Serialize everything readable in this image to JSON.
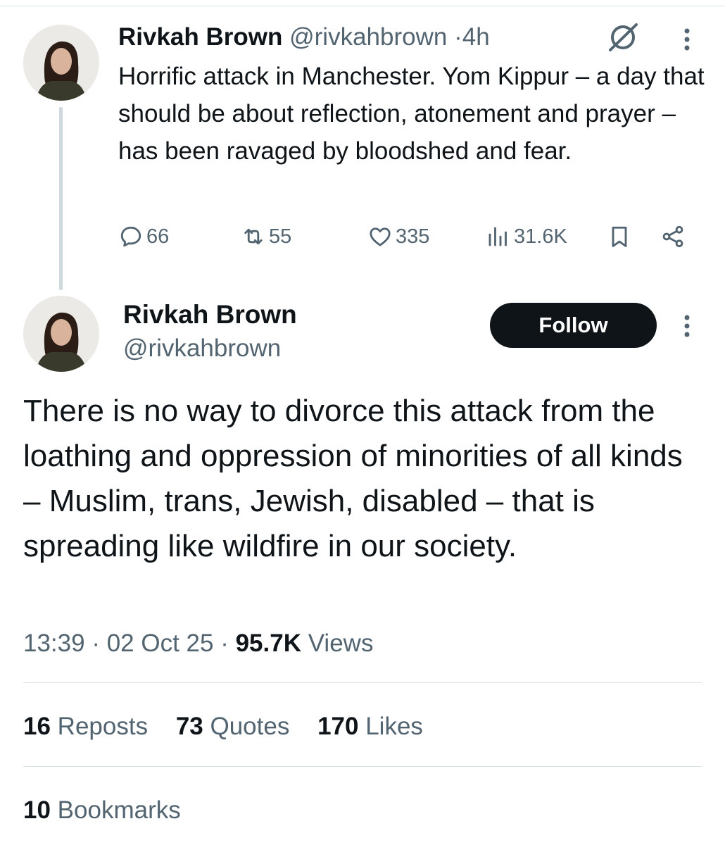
{
  "reply_tweet": {
    "author_name": "Rivkah Brown",
    "author_handle": "@rivkahbrown",
    "time_ago": "4h",
    "text": "Horrific attack in Manchester. Yom Kippur – a day that should be about reflection, atonement and prayer – has been ravaged by bloodshed and fear.",
    "replies": "66",
    "reposts": "55",
    "likes": "335",
    "views": "31.6K"
  },
  "main_tweet": {
    "author_name": "Rivkah Brown",
    "author_handle": "@rivkahbrown",
    "follow_label": "Follow",
    "text": "There is no way to divorce this attack from the loathing and oppression of minorities of all kinds – Muslim, trans, Jewish, disabled – that is spreading like wildfire in our society.",
    "time": "13:39",
    "date": "02 Oct 25",
    "views_count": "95.7K",
    "views_label": "Views",
    "reposts_count": "16",
    "reposts_label": "Reposts",
    "quotes_count": "73",
    "quotes_label": "Quotes",
    "likes_count": "170",
    "likes_label": "Likes",
    "bookmarks_count": "10",
    "bookmarks_label": "Bookmarks"
  },
  "icons": [
    "reply-icon",
    "repost-icon",
    "like-icon",
    "views-icon",
    "bookmark-icon",
    "share-icon",
    "grok-icon",
    "more-icon"
  ],
  "colors": {
    "text": "#0f1419",
    "muted": "#536471",
    "follow_bg": "#0f1419",
    "divider": "#dbe3e8"
  }
}
